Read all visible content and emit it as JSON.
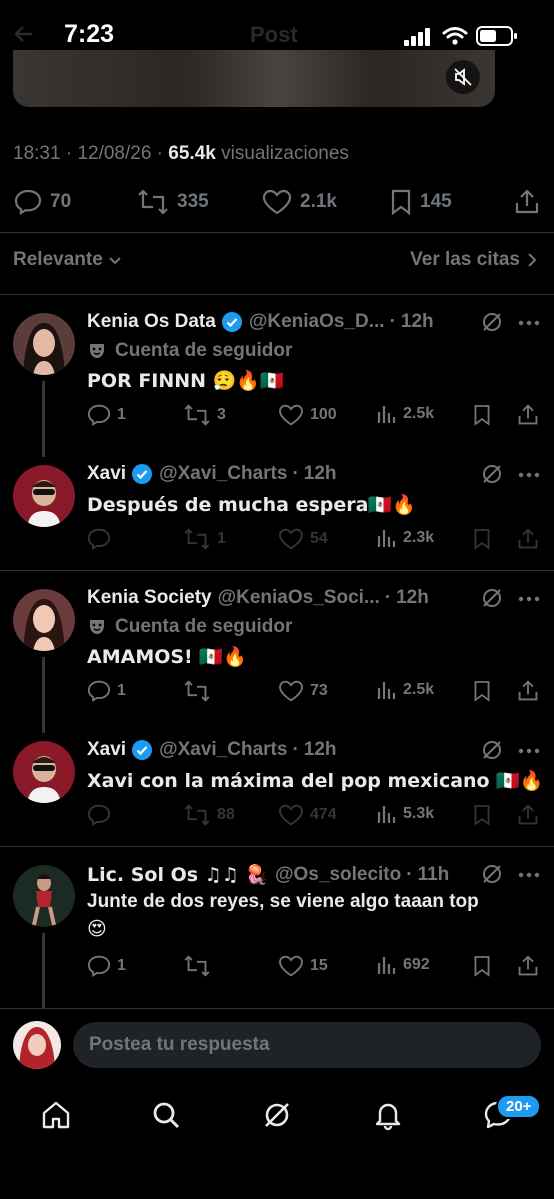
{
  "status_bar": {
    "time": "7:23"
  },
  "header": {
    "title": "Post"
  },
  "post": {
    "time": "18:31",
    "date": "12/08/26",
    "views_count": "65.4k",
    "views_label": "visualizaciones",
    "stats": {
      "replies": "70",
      "reposts": "335",
      "likes": "2.1k",
      "bookmarks": "145"
    }
  },
  "sort": {
    "label": "Relevante",
    "quotes_link": "Ver las citas"
  },
  "replies": [
    {
      "name": "Kenia Os Data",
      "verified": true,
      "handle": "@KeniaOs_D...",
      "time": "12h",
      "tag": "Cuenta de seguidor",
      "text": "POR FINNN 😮‍💨🔥🇲🇽",
      "replies": "1",
      "reposts": "3",
      "likes": "100",
      "views": "2.5k"
    },
    {
      "name": "Xavi",
      "verified": true,
      "handle": "@Xavi_Charts",
      "time": "12h",
      "text": "Después de mucha espera🇲🇽🔥",
      "replies": "",
      "reposts": "1",
      "likes": "54",
      "views": "2.3k"
    },
    {
      "name": "Kenia Society",
      "verified": false,
      "handle": "@KeniaOs_Soci...",
      "time": "12h",
      "tag": "Cuenta de seguidor",
      "text": "AMAMOS! 🇲🇽🔥",
      "replies": "1",
      "reposts": "",
      "likes": "73",
      "views": "2.5k"
    },
    {
      "name": "Xavi",
      "verified": true,
      "handle": "@Xavi_Charts",
      "time": "12h",
      "text": "Xavi con la máxima del pop mexicano 🇲🇽🔥",
      "replies": "",
      "reposts": "88",
      "likes": "474",
      "views": "5.3k"
    },
    {
      "name": "Lic. Sol Os ♫♫ 🪼",
      "verified": false,
      "handle": "@Os_solecito",
      "time": "11h",
      "text_line1": "Junte de dos reyes, se viene algo taaan top",
      "text_line2": "😍",
      "replies": "1",
      "reposts": "",
      "likes": "15",
      "views": "692"
    }
  ],
  "reply_bar": {
    "placeholder": "Postea tu respuesta"
  },
  "bottom_nav": {
    "messages_badge": "20+"
  },
  "colors": {
    "background": "#000000",
    "text": "#e7e9ea",
    "muted": "#71767b",
    "accent": "#1d9bf0",
    "divider": "#2f3336"
  }
}
